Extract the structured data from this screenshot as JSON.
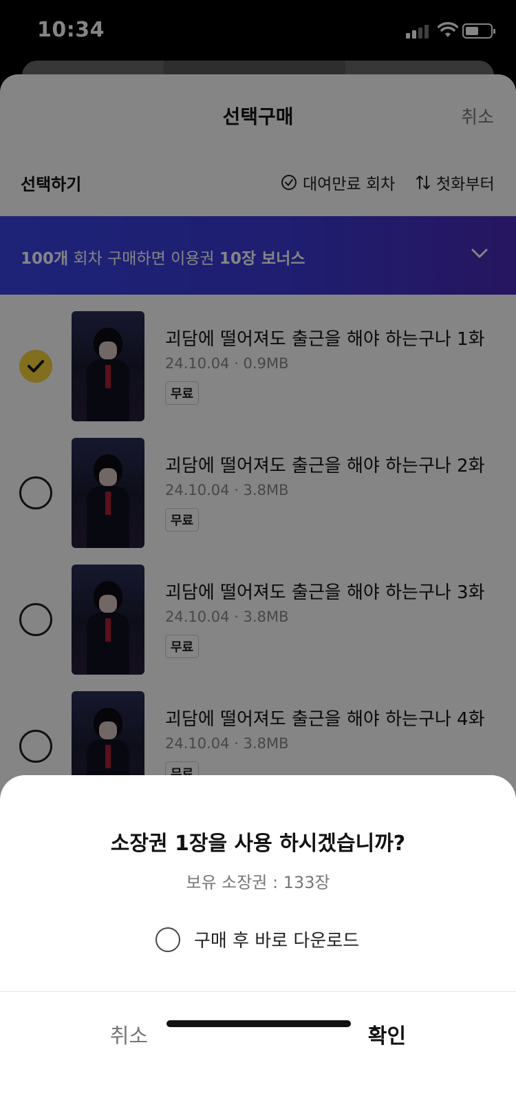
{
  "status_bar": {
    "time": "10:34"
  },
  "sheet": {
    "title": "선택구매",
    "cancel_label": "취소",
    "toolbar": {
      "select_label": "선택하기",
      "filter_label": "대여만료 회차",
      "sort_label": "첫화부터"
    },
    "banner": {
      "count": "100개",
      "text_mid": " 회차 구매하면 이용권 ",
      "bonus": "10장 보너스"
    },
    "episodes": [
      {
        "title": "괴담에 떨어져도 출근을 해야 하는구나 1화",
        "date": "24.10.04",
        "size": "0.9MB",
        "badge": "무료",
        "selected": true
      },
      {
        "title": "괴담에 떨어져도 출근을 해야 하는구나 2화",
        "date": "24.10.04",
        "size": "3.8MB",
        "badge": "무료",
        "selected": false
      },
      {
        "title": "괴담에 떨어져도 출근을 해야 하는구나 3화",
        "date": "24.10.04",
        "size": "3.8MB",
        "badge": "무료",
        "selected": false
      },
      {
        "title": "괴담에 떨어져도 출근을 해야 하는구나 4화",
        "date": "24.10.04",
        "size": "3.8MB",
        "badge": "무료",
        "selected": false
      }
    ]
  },
  "dialog": {
    "question": "소장권 1장을 사용 하시겠습니까?",
    "owned": "보유 소장권 : 133장",
    "option_label": "구매 후 바로 다운로드",
    "cancel_label": "취소",
    "confirm_label": "확인"
  },
  "colors": {
    "banner_start": "#3a44e6",
    "banner_end": "#4a2ab8",
    "check_selected": "#f7d33a"
  }
}
